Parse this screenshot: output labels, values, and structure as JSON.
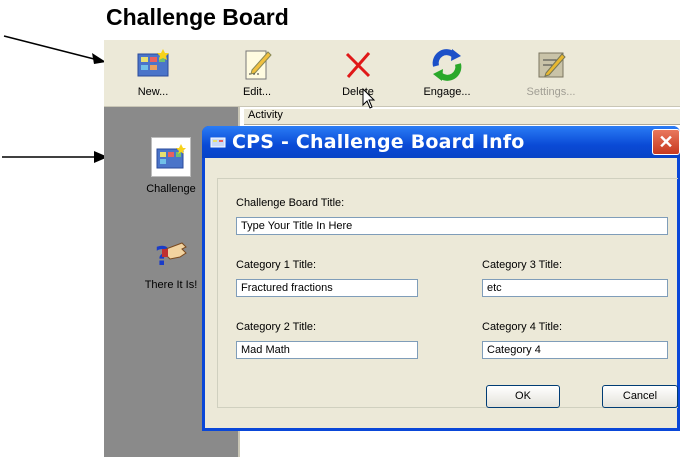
{
  "document_title": "Challenge Board",
  "toolbar": {
    "items": [
      {
        "label": "New...",
        "icon": "new-board-icon",
        "enabled": true
      },
      {
        "label": "Edit...",
        "icon": "edit-pencil-icon",
        "enabled": true
      },
      {
        "label": "Delete",
        "icon": "delete-x-icon",
        "enabled": true
      },
      {
        "label": "Engage...",
        "icon": "engage-arrows-icon",
        "enabled": true
      },
      {
        "label": "Settings...",
        "icon": "settings-icon",
        "enabled": false
      }
    ]
  },
  "sidebar": {
    "items": [
      {
        "label": "Challenge",
        "icon": "challenge-board-icon"
      },
      {
        "label": "There It Is!",
        "icon": "pointing-hand-icon"
      }
    ]
  },
  "list": {
    "column_header": "Activity"
  },
  "dialog": {
    "title": "CPS - Challenge Board Info",
    "board_title_label": "Challenge Board Title:",
    "board_title_value": "Type Your Title In Here",
    "cat1_label": "Category 1 Title:",
    "cat1_value": "Fractured fractions",
    "cat2_label": "Category 2 Title:",
    "cat2_value": "Mad Math",
    "cat3_label": "Category 3 Title:",
    "cat3_value": "etc",
    "cat4_label": "Category 4 Title:",
    "cat4_value": "Category 4",
    "ok_label": "OK",
    "cancel_label": "Cancel"
  },
  "colors": {
    "titlebar_blue": "#0a4ad6",
    "close_red": "#c7391f",
    "sidebar_gray": "#8a8a8a",
    "window_bg": "#ece9d8"
  }
}
